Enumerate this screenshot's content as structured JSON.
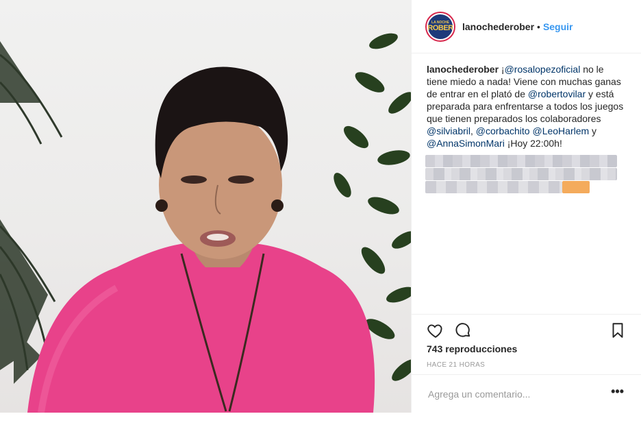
{
  "account": {
    "username": "lanochederober",
    "separator": "•",
    "follow_label": "Seguir",
    "avatar_logo_top": "LA NOCHE",
    "avatar_logo_bottom": "ROBER"
  },
  "caption": {
    "username": "lanochederober",
    "t1": " ¡",
    "mention1": "@rosalopezoficial",
    "t2": " no le tiene miedo a nada! Viene con muchas ganas de entrar en el plató de ",
    "mention2": "@robertovilar",
    "t3": " y está preparada para enfrentarse a todos los juegos que tienen preparados los colaboradores ",
    "mention3": "@silviabril",
    "t4": ", ",
    "mention4": "@corbachito",
    "t5": " ",
    "mention5": "@LeoHarlem",
    "t6": " y ",
    "mention6": "@AnnaSimonMari",
    "t7": " ¡Hoy 22:00h!"
  },
  "actions": {
    "like_icon": "heart-icon",
    "comment_icon": "comment-icon",
    "save_icon": "bookmark-icon",
    "views": "743 reproducciones",
    "time_ago": "HACE 21 HORAS"
  },
  "comment": {
    "placeholder": "Agrega un comentario...",
    "more_label": "•••"
  },
  "colors": {
    "link": "#3897f0",
    "mention": "#003569",
    "sweater": "#e8428a",
    "hair": "#1b1414"
  }
}
